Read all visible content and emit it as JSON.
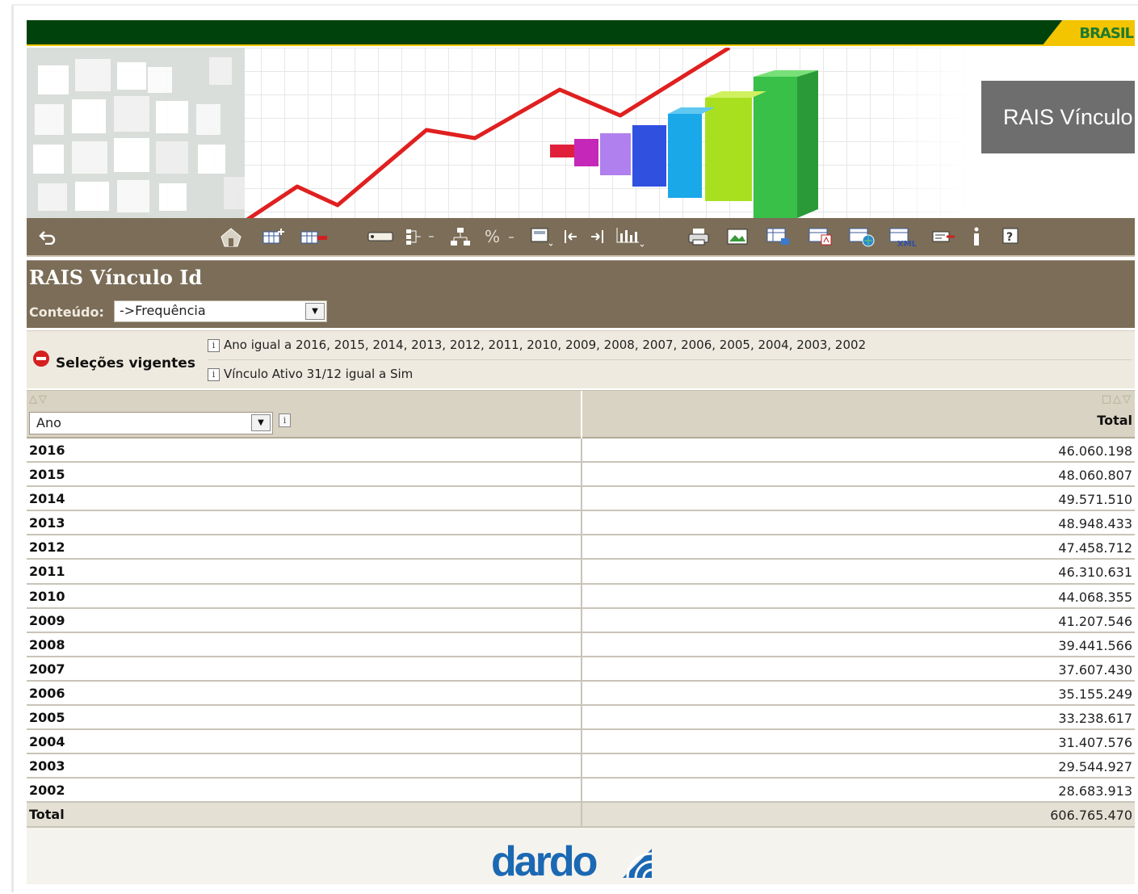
{
  "header": {
    "gov_brand": "BRASIL",
    "banner_title": "RAIS Vínculo",
    "accent_green": "#00420c",
    "accent_yellow": "#f3c400"
  },
  "toolbar": {
    "icons": [
      "undo-icon",
      "home-icon",
      "add-table-icon",
      "remove-table-icon",
      "label-icon",
      "tree-icon",
      "hierarchy-icon",
      "percent-icon",
      "calculator-icon",
      "move-left-icon",
      "move-right-icon",
      "chart-icon",
      "print-icon",
      "image-export-icon",
      "table-export-icon",
      "pdf-export-icon",
      "web-export-icon",
      "xml-export-icon",
      "edit-icon",
      "info-icon",
      "help-icon"
    ]
  },
  "page": {
    "title": "RAIS Vínculo Id",
    "content_label": "Conteúdo:",
    "content_value": "->Frequência"
  },
  "selections": {
    "label": "Seleções vigentes",
    "items": [
      "Ano igual a 2016, 2015, 2014, 2013, 2012, 2011, 2010, 2009, 2008, 2007, 2006, 2005, 2004, 2003, 2002",
      "Vínculo Ativo 31/12 igual a Sim"
    ]
  },
  "table": {
    "row_dimension": "Ano",
    "column_header": "Total",
    "rows": [
      {
        "label": "2016",
        "value": "46.060.198"
      },
      {
        "label": "2015",
        "value": "48.060.807"
      },
      {
        "label": "2014",
        "value": "49.571.510"
      },
      {
        "label": "2013",
        "value": "48.948.433"
      },
      {
        "label": "2012",
        "value": "47.458.712"
      },
      {
        "label": "2011",
        "value": "46.310.631"
      },
      {
        "label": "2010",
        "value": "44.068.355"
      },
      {
        "label": "2009",
        "value": "41.207.546"
      },
      {
        "label": "2008",
        "value": "39.441.566"
      },
      {
        "label": "2007",
        "value": "37.607.430"
      },
      {
        "label": "2006",
        "value": "35.155.249"
      },
      {
        "label": "2005",
        "value": "33.238.617"
      },
      {
        "label": "2004",
        "value": "31.407.576"
      },
      {
        "label": "2003",
        "value": "29.544.927"
      },
      {
        "label": "2002",
        "value": "28.683.913"
      }
    ],
    "total": {
      "label": "Total",
      "value": "606.765.470"
    }
  },
  "footer": {
    "logo": "dardo"
  }
}
